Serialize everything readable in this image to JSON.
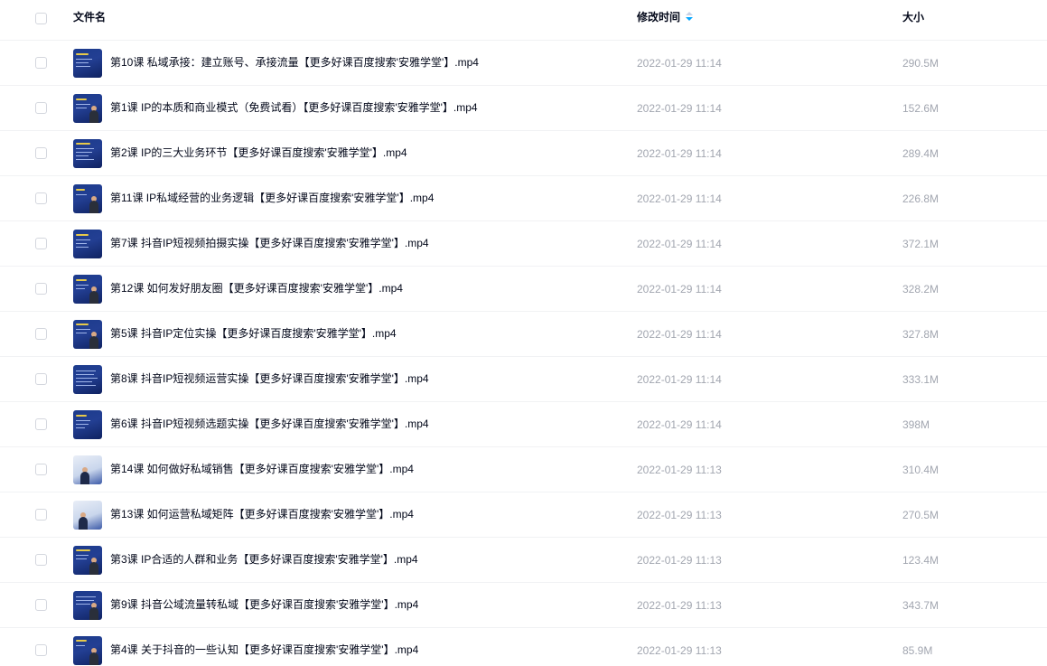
{
  "header": {
    "name_label": "文件名",
    "time_label": "修改时间",
    "size_label": "大小",
    "sort_icon": "sort-arrows-icon",
    "sort_active_color": "#06a7ff"
  },
  "files": [
    {
      "name": "第10课 私域承接：建立账号、承接流量【更多好课百度搜索'安雅学堂'】.mp4",
      "time": "2022-01-29 11:14",
      "size": "290.5M"
    },
    {
      "name": "第1课 IP的本质和商业模式（免费试看）【更多好课百度搜索'安雅学堂'】.mp4",
      "time": "2022-01-29 11:14",
      "size": "152.6M"
    },
    {
      "name": "第2课 IP的三大业务环节【更多好课百度搜索'安雅学堂'】.mp4",
      "time": "2022-01-29 11:14",
      "size": "289.4M"
    },
    {
      "name": "第11课 IP私域经营的业务逻辑【更多好课百度搜索'安雅学堂'】.mp4",
      "time": "2022-01-29 11:14",
      "size": "226.8M"
    },
    {
      "name": "第7课 抖音IP短视频拍摄实操【更多好课百度搜索'安雅学堂'】.mp4",
      "time": "2022-01-29 11:14",
      "size": "372.1M"
    },
    {
      "name": "第12课 如何发好朋友圈【更多好课百度搜索'安雅学堂'】.mp4",
      "time": "2022-01-29 11:14",
      "size": "328.2M"
    },
    {
      "name": "第5课 抖音IP定位实操【更多好课百度搜索'安雅学堂'】.mp4",
      "time": "2022-01-29 11:14",
      "size": "327.8M"
    },
    {
      "name": "第8课 抖音IP短视频运营实操【更多好课百度搜索'安雅学堂'】.mp4",
      "time": "2022-01-29 11:14",
      "size": "333.1M"
    },
    {
      "name": "第6课 抖音IP短视频选题实操【更多好课百度搜索'安雅学堂'】.mp4",
      "time": "2022-01-29 11:14",
      "size": "398M"
    },
    {
      "name": "第14课 如何做好私域销售【更多好课百度搜索'安雅学堂'】.mp4",
      "time": "2022-01-29 11:13",
      "size": "310.4M"
    },
    {
      "name": "第13课 如何运营私域矩阵【更多好课百度搜索'安雅学堂'】.mp4",
      "time": "2022-01-29 11:13",
      "size": "270.5M"
    },
    {
      "name": "第3课 IP合适的人群和业务【更多好课百度搜索'安雅学堂'】.mp4",
      "time": "2022-01-29 11:13",
      "size": "123.4M"
    },
    {
      "name": "第9课 抖音公域流量转私域【更多好课百度搜索'安雅学堂'】.mp4",
      "time": "2022-01-29 11:13",
      "size": "343.7M"
    },
    {
      "name": "第4课 关于抖音的一些认知【更多好课百度搜索'安雅学堂'】.mp4",
      "time": "2022-01-29 11:13",
      "size": "85.9M"
    }
  ]
}
